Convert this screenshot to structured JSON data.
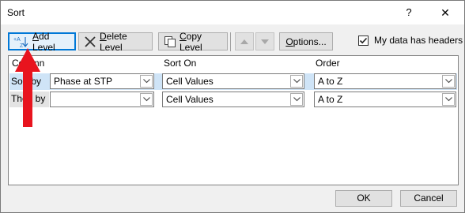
{
  "window": {
    "title": "Sort",
    "help": "?",
    "close": "✕"
  },
  "toolbar": {
    "add_level": {
      "pre": "",
      "u": "A",
      "post": "dd Level"
    },
    "delete_level": {
      "pre": "",
      "u": "D",
      "post": "elete Level"
    },
    "copy_level": {
      "pre": "",
      "u": "C",
      "post": "opy Level"
    },
    "options": {
      "pre": "",
      "u": "O",
      "post": "ptions..."
    },
    "headers_checkbox": {
      "pre": "My data has ",
      "u": "h",
      "post": "eaders",
      "checked": true
    }
  },
  "grid": {
    "headers": {
      "column": "Column",
      "sort_on": "Sort On",
      "order": "Order"
    },
    "rows": [
      {
        "label": "Sort by",
        "column": "Phase at STP",
        "sort_on": "Cell Values",
        "order": "A to Z"
      },
      {
        "label": "Then by",
        "column": "",
        "sort_on": "Cell Values",
        "order": "A to Z"
      }
    ]
  },
  "footer": {
    "ok": "OK",
    "cancel": "Cancel"
  },
  "colors": {
    "accent": "#0078d7",
    "selected_row": "#cfe4f7",
    "arrow": "#e8141e"
  }
}
